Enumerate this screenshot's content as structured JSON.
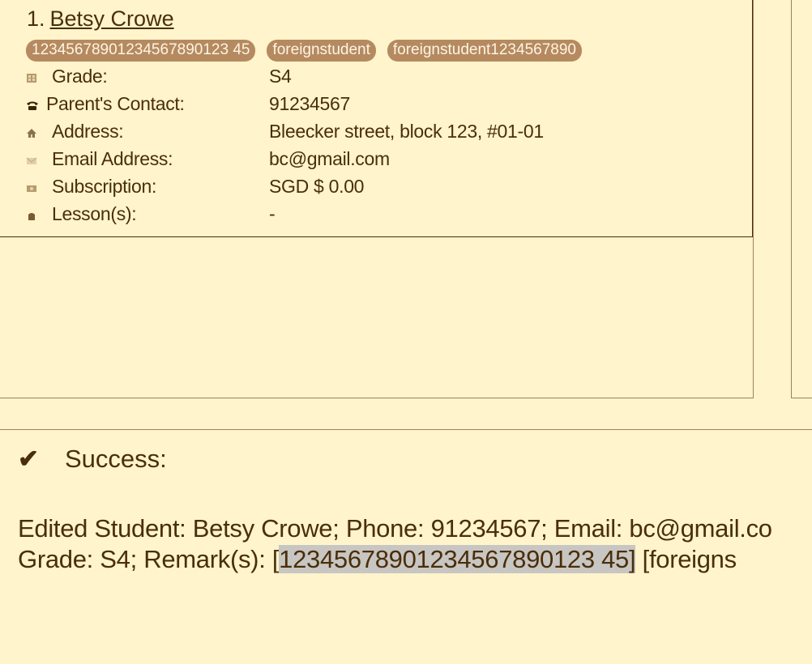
{
  "student_card": {
    "index": "1.",
    "name": "Betsy Crowe",
    "tags": [
      "12345678901234567890123 45",
      "foreignstudent",
      "foreignstudent1234567890"
    ],
    "fields": [
      {
        "label": "Grade:",
        "value": "S4",
        "icon": "grade-icon"
      },
      {
        "label": "Parent's Contact:",
        "value": "91234567",
        "icon": "phone-icon"
      },
      {
        "label": "Address:",
        "value": "Bleecker street, block 123, #01-01",
        "icon": "home-icon"
      },
      {
        "label": "Email Address:",
        "value": "bc@gmail.com",
        "icon": "email-icon"
      },
      {
        "label": "Subscription:",
        "value": "SGD $ 0.00",
        "icon": "subscription-icon"
      },
      {
        "label": "Lesson(s):",
        "value": "-",
        "icon": "lesson-icon"
      }
    ]
  },
  "result": {
    "check": "✔",
    "status": "Success:",
    "line1": "Edited Student: Betsy Crowe; Phone: 91234567; Email: bc@gmail.co",
    "line2_prefix": "Grade: S4; Remark(s): [",
    "line2_highlight": "12345678901234567890123 45",
    "line2_highlight_end": "]",
    "line2_suffix": " [foreigns"
  },
  "colors": {
    "background": "#fff4cb",
    "text": "#4a2e0a",
    "tag_bg": "#b58a60",
    "tag_text": "#fff4e2",
    "highlight": "#c8c6c2"
  }
}
